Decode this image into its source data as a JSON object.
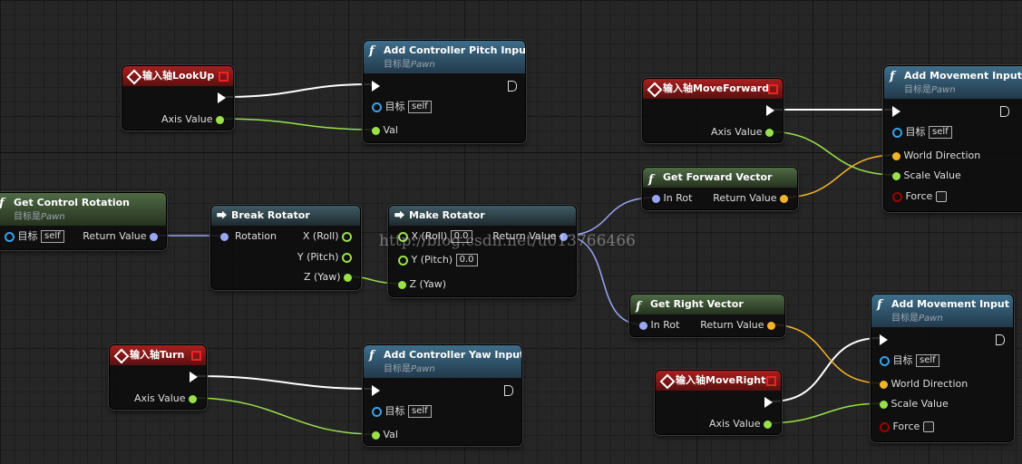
{
  "colors": {
    "exec": "#ffffff",
    "float": "#9ae04a",
    "rotator": "#9aa6f5",
    "vector": "#f4b42a",
    "object": "#3aa0e8",
    "bool": "#a00000"
  },
  "watermark": "http://blog.csdn.net/u013766466",
  "nodes": {
    "lookup": {
      "title": "输入轴LookUp",
      "axis_label": "Axis Value"
    },
    "pitch": {
      "title": "Add Controller Pitch Input",
      "subtitle_prefix": "目标是",
      "subtitle_class": "Pawn",
      "target_label": "目标",
      "target_value": "self",
      "val_label": "Val"
    },
    "moveforward": {
      "title": "输入轴MoveForward",
      "axis_label": "Axis Value"
    },
    "move1": {
      "title": "Add Movement Input",
      "subtitle_prefix": "目标是",
      "subtitle_class": "Pawn",
      "target_label": "目标",
      "target_value": "self",
      "dir_label": "World Direction",
      "scale_label": "Scale Value",
      "force_label": "Force"
    },
    "getcontrol": {
      "title": "Get Control Rotation",
      "subtitle_prefix": "目标是",
      "subtitle_class": "Pawn",
      "target_label": "目标",
      "target_value": "self",
      "return_label": "Return Value"
    },
    "break": {
      "title": "Break Rotator",
      "in_label": "Rotation",
      "x_label": "X (Roll)",
      "y_label": "Y (Pitch)",
      "z_label": "Z (Yaw)"
    },
    "make": {
      "title": "Make Rotator",
      "x_label": "X (Roll)",
      "x_value": "0.0",
      "y_label": "Y (Pitch)",
      "y_value": "0.0",
      "z_label": "Z (Yaw)",
      "return_label": "Return Value"
    },
    "forward": {
      "title": "Get Forward Vector",
      "in_label": "In Rot",
      "return_label": "Return Value"
    },
    "right": {
      "title": "Get Right Vector",
      "in_label": "In Rot",
      "return_label": "Return Value"
    },
    "turn": {
      "title": "输入轴Turn",
      "axis_label": "Axis Value"
    },
    "yaw": {
      "title": "Add Controller Yaw Input",
      "subtitle_prefix": "目标是",
      "subtitle_class": "Pawn",
      "target_label": "目标",
      "target_value": "self",
      "val_label": "Val"
    },
    "moveright": {
      "title": "输入轴MoveRight",
      "axis_label": "Axis Value"
    },
    "move2": {
      "title": "Add Movement Input",
      "subtitle_prefix": "目标是",
      "subtitle_class": "Pawn",
      "target_label": "目标",
      "target_value": "self",
      "dir_label": "World Direction",
      "scale_label": "Scale Value",
      "force_label": "Force"
    }
  }
}
